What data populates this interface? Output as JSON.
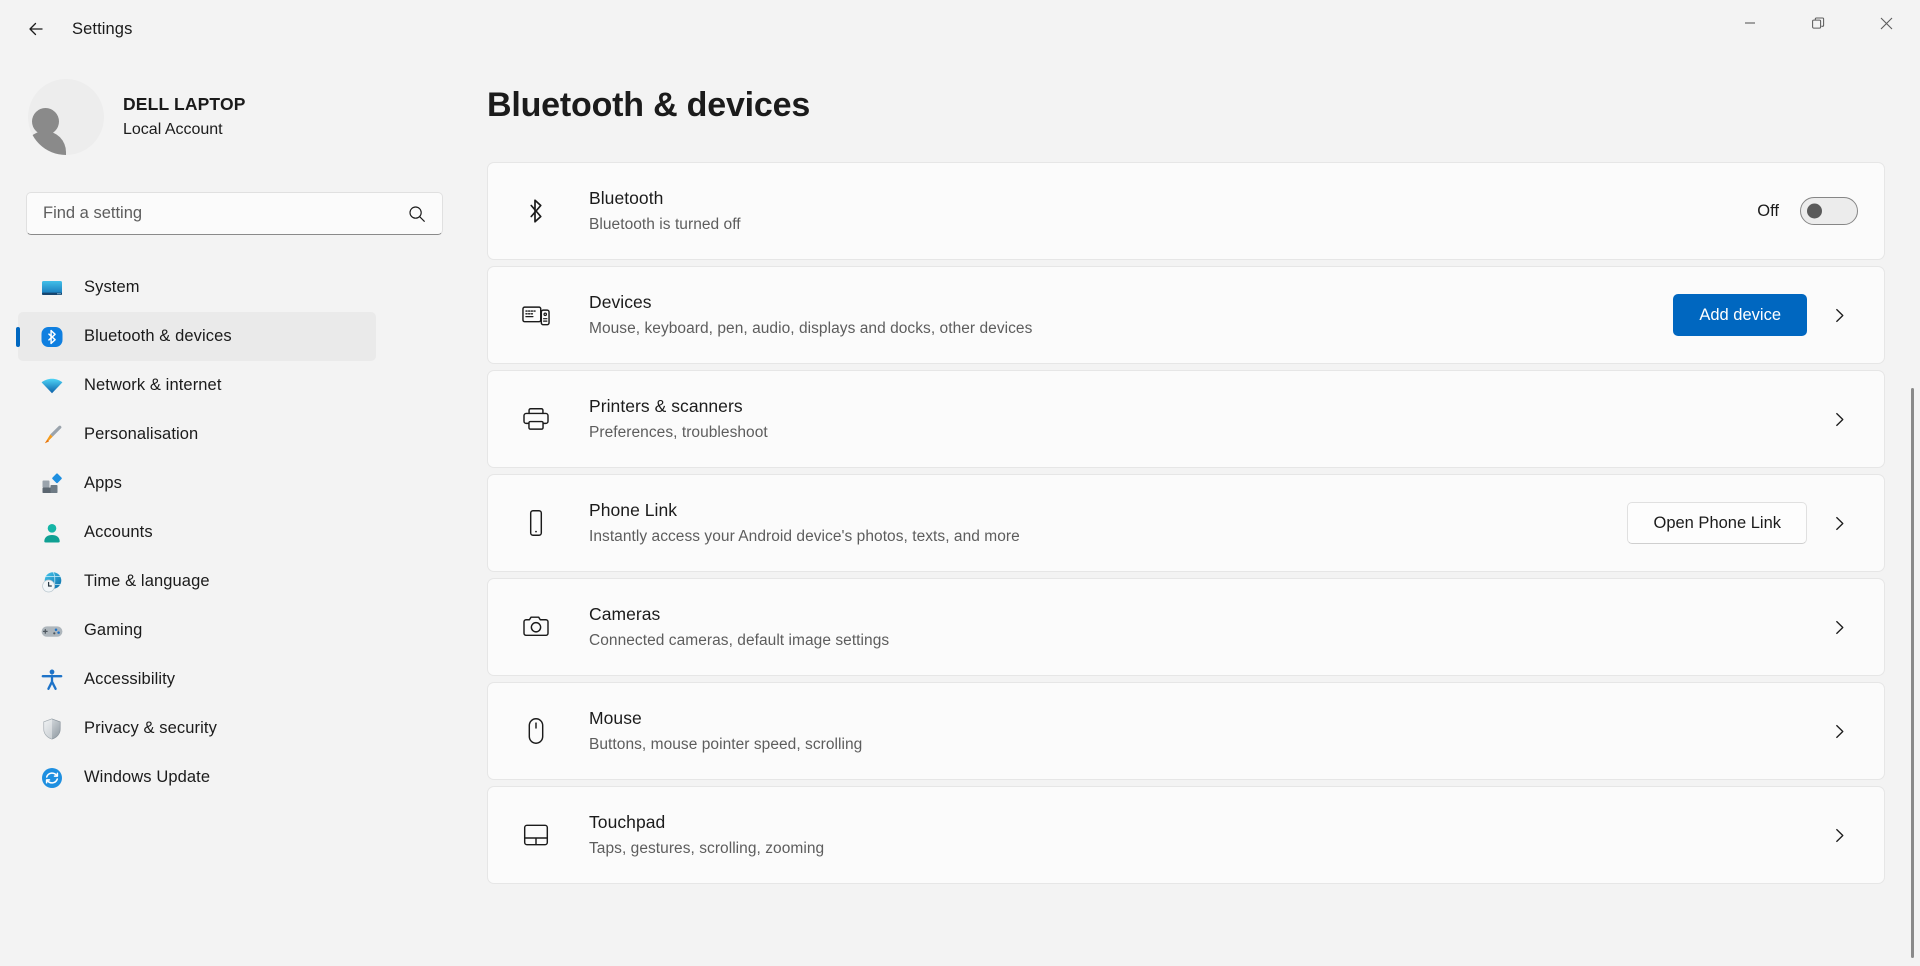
{
  "window": {
    "title": "Settings",
    "back_label": "Back",
    "minimize_label": "Minimize",
    "maximize_label": "Restore",
    "close_label": "Close"
  },
  "account": {
    "name": "DELL LAPTOP",
    "type": "Local Account"
  },
  "search": {
    "placeholder": "Find a setting",
    "value": ""
  },
  "sidebar": {
    "items": [
      {
        "label": "System",
        "icon": "monitor-icon",
        "selected": false
      },
      {
        "label": "Bluetooth & devices",
        "icon": "bluetooth-icon",
        "selected": true
      },
      {
        "label": "Network & internet",
        "icon": "wifi-icon",
        "selected": false
      },
      {
        "label": "Personalisation",
        "icon": "paintbrush-icon",
        "selected": false
      },
      {
        "label": "Apps",
        "icon": "apps-icon",
        "selected": false
      },
      {
        "label": "Accounts",
        "icon": "person-icon",
        "selected": false
      },
      {
        "label": "Time & language",
        "icon": "clock-globe-icon",
        "selected": false
      },
      {
        "label": "Gaming",
        "icon": "gamepad-icon",
        "selected": false
      },
      {
        "label": "Accessibility",
        "icon": "accessibility-icon",
        "selected": false
      },
      {
        "label": "Privacy & security",
        "icon": "shield-icon",
        "selected": false
      },
      {
        "label": "Windows Update",
        "icon": "update-icon",
        "selected": false
      }
    ]
  },
  "main": {
    "page_title": "Bluetooth & devices",
    "cards": [
      {
        "title": "Bluetooth",
        "subtitle": "Bluetooth is turned off",
        "icon": "bluetooth-glyph-icon",
        "control": "toggle",
        "toggle_state": "Off",
        "toggle_on": false,
        "chevron": false
      },
      {
        "title": "Devices",
        "subtitle": "Mouse, keyboard, pen, audio, displays and docks, other devices",
        "icon": "devices-icon",
        "control": "primary-button",
        "button_label": "Add device",
        "chevron": true
      },
      {
        "title": "Printers & scanners",
        "subtitle": "Preferences, troubleshoot",
        "icon": "printer-icon",
        "control": "none",
        "chevron": true
      },
      {
        "title": "Phone Link",
        "subtitle": "Instantly access your Android device's photos, texts, and more",
        "icon": "phone-icon",
        "control": "secondary-button",
        "button_label": "Open Phone Link",
        "chevron": true
      },
      {
        "title": "Cameras",
        "subtitle": "Connected cameras, default image settings",
        "icon": "camera-icon",
        "control": "none",
        "chevron": true
      },
      {
        "title": "Mouse",
        "subtitle": "Buttons, mouse pointer speed, scrolling",
        "icon": "mouse-icon",
        "control": "none",
        "chevron": true
      },
      {
        "title": "Touchpad",
        "subtitle": "Taps, gestures, scrolling, zooming",
        "icon": "touchpad-icon",
        "control": "none",
        "chevron": true
      }
    ]
  },
  "colors": {
    "accent": "#0067C0",
    "page_bg": "#F3F3F3",
    "card_bg": "#FBFBFB",
    "selected_nav_bg": "#EAEAEA",
    "subtext": "#5D5D5D"
  }
}
